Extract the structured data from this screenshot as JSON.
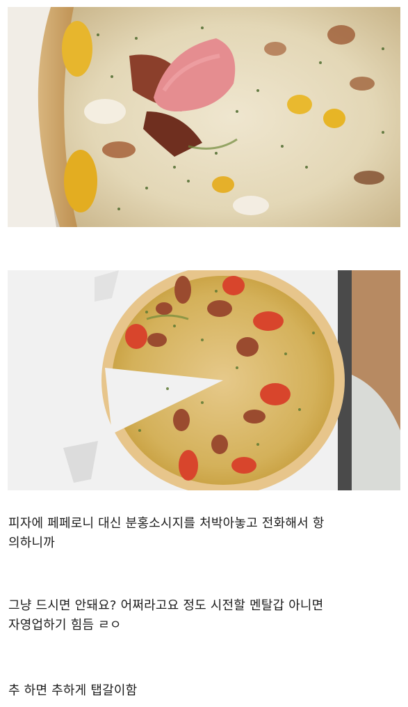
{
  "post": {
    "images": [
      {
        "name": "pizza-closeup-photo"
      },
      {
        "name": "pizza-overview-photo"
      }
    ],
    "paragraphs": [
      "피자에 페페로니 대신 분홍소시지를 처박아놓고 전화해서 항\n의하니까",
      "그냥 드시면 안돼요? 어쩌라고요 정도 시전할 멘탈갑 아니면\n자영업하기 힘듬 ㄹㅇ",
      "추 하면 추하게 탭갈이함"
    ]
  }
}
